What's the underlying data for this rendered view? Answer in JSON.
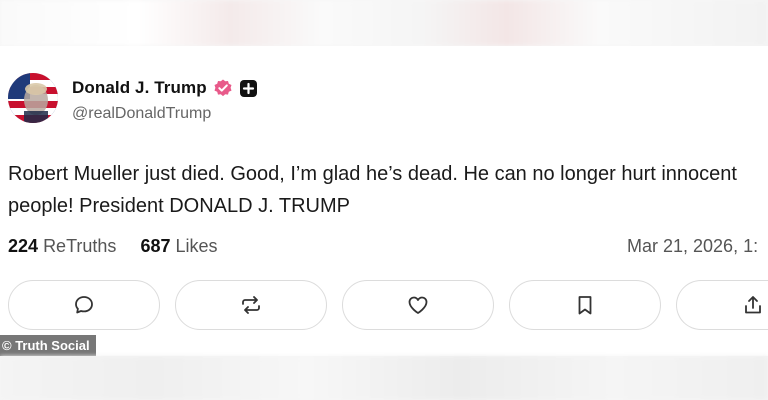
{
  "post": {
    "author": {
      "display_name": "Donald J. Trump",
      "handle": "@realDonaldTrump",
      "verified_icon": "verified-badge-icon",
      "extra_icon": "plus-badge-icon"
    },
    "text": "Robert Mueller just died. Good, I’m glad he’s dead. He can no longer hurt innocent people! President DONALD J. TRUMP",
    "stats": {
      "retruths_count": "224",
      "retruths_label": "ReTruths",
      "likes_count": "687",
      "likes_label": "Likes"
    },
    "timestamp": "Mar 21, 2026, 1:"
  },
  "actions": [
    {
      "name": "reply",
      "icon": "comment-icon"
    },
    {
      "name": "retruth",
      "icon": "repost-icon"
    },
    {
      "name": "like",
      "icon": "heart-icon"
    },
    {
      "name": "bookmark",
      "icon": "bookmark-icon"
    },
    {
      "name": "share",
      "icon": "share-icon"
    }
  ],
  "watermark": "© Truth Social",
  "colors": {
    "verified_badge": "#e85a8a",
    "text_primary": "#111111",
    "text_secondary": "#666666",
    "button_border": "#dcdcdc"
  }
}
